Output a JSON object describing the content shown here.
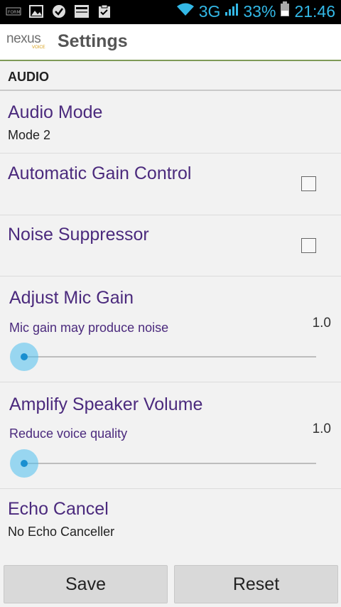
{
  "status_bar": {
    "network": "3G",
    "battery": "33%",
    "time": "21:46",
    "icons": [
      "notification-icon",
      "image-icon",
      "check-icon",
      "news-icon",
      "clipboard-icon",
      "wifi-icon",
      "signal-icon",
      "battery-icon"
    ]
  },
  "app": {
    "logo_text": "nexus",
    "logo_sub": "VOICE",
    "title": "Settings"
  },
  "section": {
    "label": "AUDIO"
  },
  "prefs": {
    "audio_mode": {
      "title": "Audio Mode",
      "summary": "Mode 2"
    },
    "agc": {
      "title": "Automatic Gain Control",
      "checked": false
    },
    "noise": {
      "title": "Noise Suppressor",
      "checked": false
    },
    "mic_gain": {
      "title": "Adjust Mic Gain",
      "summary": "Mic gain may produce noise",
      "value": "1.0",
      "slider_level": 0
    },
    "speaker": {
      "title": "Amplify Speaker Volume",
      "summary": "Reduce voice quality",
      "value": "1.0",
      "slider_level": 0
    },
    "echo": {
      "title": "Echo Cancel",
      "summary": "No Echo Canceller"
    }
  },
  "buttons": {
    "save": "Save",
    "reset": "Reset"
  },
  "colors": {
    "accent": "#4b2a7d",
    "status_accent": "#33b8e6",
    "slider": "#4fbfef",
    "divider": "#7f9a57"
  }
}
